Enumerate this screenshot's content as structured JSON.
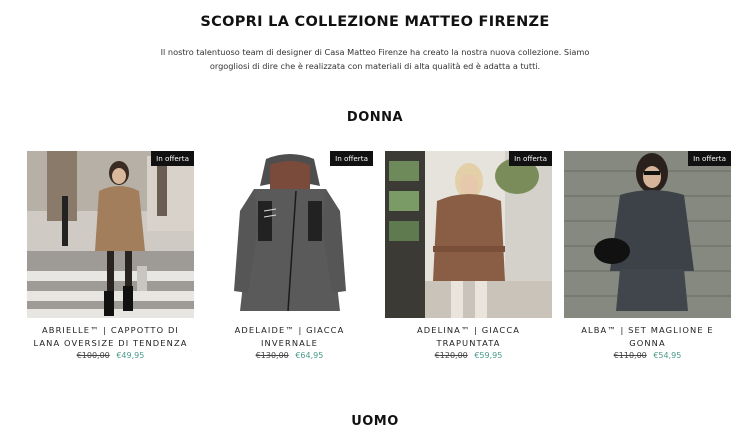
{
  "hero": {
    "title": "SCOPRI LA COLLEZIONE MATTEO FIRENZE",
    "description": "Il nostro talentuoso team di designer di Casa Matteo Firenze ha creato la nostra nuova collezione. Siamo orgogliosi di dire che è realizzata con materiali di alta qualità ed è adatta a tutti."
  },
  "sections": {
    "donna": "DONNA",
    "uomo": "UOMO"
  },
  "products": [
    {
      "badge": "In offerta",
      "title": "ABRIELLE™ | CAPPOTTO DI LANA OVERSIZE DI TENDENZA",
      "price_old": "€100,00",
      "price_new": "€49,95",
      "image_icon": "woman-beige-coat-photo"
    },
    {
      "badge": "In offerta",
      "title": "ADELAIDE™ | GIACCA INVERNALE",
      "price_old": "€130,00",
      "price_new": "€64,95",
      "image_icon": "grey-winter-jacket-photo"
    },
    {
      "badge": "In offerta",
      "title": "ADELINA™ | GIACCA TRAPUNTATA",
      "price_old": "€120,00",
      "price_new": "€59,95",
      "image_icon": "woman-brown-puffer-photo"
    },
    {
      "badge": "In offerta",
      "title": "ALBA™ | SET MAGLIONE E GONNA",
      "price_old": "€110,00",
      "price_new": "€54,95",
      "image_icon": "woman-grey-sweater-set-photo"
    }
  ],
  "colors": {
    "badge_bg": "#111111",
    "sale_price": "#4a9a8a"
  }
}
